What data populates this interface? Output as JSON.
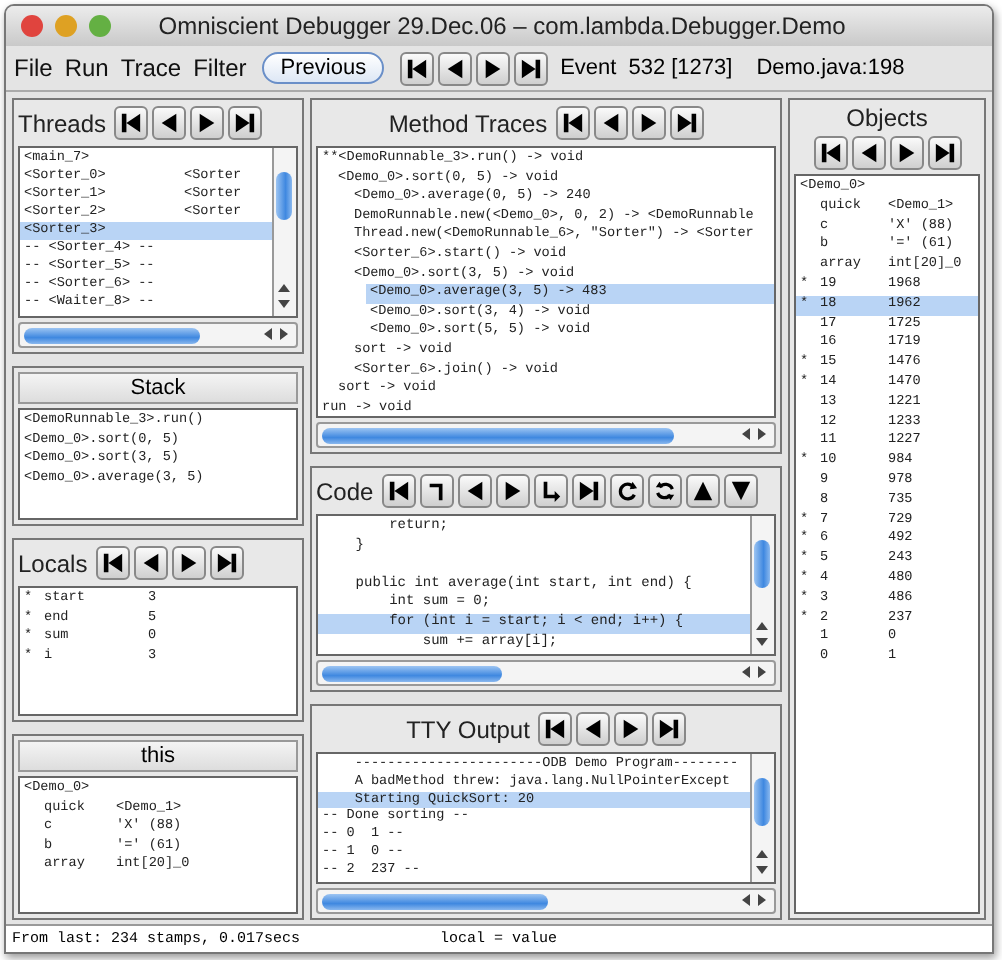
{
  "window": {
    "title": "Omniscient Debugger 29.Dec.06 – com.lambda.Debugger.Demo"
  },
  "menu": [
    "File",
    "Run",
    "Trace",
    "Filter"
  ],
  "toolbar": {
    "previous_button": "Previous",
    "nav": [
      {
        "kind": "first"
      },
      {
        "kind": "prev"
      },
      {
        "kind": "next"
      },
      {
        "kind": "last"
      }
    ],
    "event_label": "Event",
    "event_value": "532 [1273]",
    "location": "Demo.java:198"
  },
  "threads": {
    "title": "Threads",
    "nav": [
      {
        "kind": "first"
      },
      {
        "kind": "prev"
      },
      {
        "kind": "next"
      },
      {
        "kind": "last"
      }
    ],
    "rows": [
      {
        "cells": [
          "<main_7>"
        ],
        "selected": false
      },
      {
        "cells": [
          "<Sorter_0>",
          "<Sorter"
        ],
        "selected": false
      },
      {
        "cells": [
          "<Sorter_1>",
          "<Sorter"
        ],
        "selected": false
      },
      {
        "cells": [
          "<Sorter_2>",
          "<Sorter"
        ],
        "selected": false
      },
      {
        "cells": [
          "<Sorter_3>"
        ],
        "selected": true
      },
      {
        "cells": [
          "-- <Sorter_4> --"
        ],
        "selected": false
      },
      {
        "cells": [
          "-- <Sorter_5> --"
        ],
        "selected": false
      },
      {
        "cells": [
          "-- <Sorter_6> --"
        ],
        "selected": false
      },
      {
        "cells": [
          "-- <Waiter_8> --"
        ],
        "selected": false
      }
    ]
  },
  "stack": {
    "title": "Stack",
    "rows": [
      "<DemoRunnable_3>.run()",
      "<Demo_0>.sort(0, 5)",
      "<Demo_0>.sort(3, 5)",
      "<Demo_0>.average(3, 5)"
    ]
  },
  "locals": {
    "title": "Locals",
    "nav": [
      {
        "kind": "first"
      },
      {
        "kind": "prev"
      },
      {
        "kind": "next"
      },
      {
        "kind": "last"
      }
    ],
    "rows": [
      {
        "mark": "*",
        "name": "start",
        "value": "3"
      },
      {
        "mark": "*",
        "name": "end",
        "value": "5"
      },
      {
        "mark": "*",
        "name": "sum",
        "value": "0"
      },
      {
        "mark": "*",
        "name": "i",
        "value": "3"
      }
    ]
  },
  "this": {
    "title": "this",
    "header": "<Demo_0>",
    "rows": [
      {
        "name": "quick",
        "value": "<Demo_1>"
      },
      {
        "name": "c",
        "value": "'X' (88)"
      },
      {
        "name": "b",
        "value": "'=' (61)"
      },
      {
        "name": "array",
        "value": "int[20]_0"
      }
    ]
  },
  "method_traces": {
    "title": "Method Traces",
    "nav": [
      {
        "kind": "first"
      },
      {
        "kind": "prev"
      },
      {
        "kind": "next"
      },
      {
        "kind": "last"
      }
    ],
    "items": [
      {
        "text": "**<DemoRunnable_3>.run() -> void",
        "selected": false,
        "children": [
          {
            "text": "<Demo_0>.sort(0, 5) -> void",
            "selected": false,
            "children": [
              {
                "text": "<Demo_0>.average(0, 5) -> 240",
                "selected": false
              },
              {
                "text": "DemoRunnable.new(<Demo_0>, 0, 2) -> <DemoRunnable",
                "selected": false
              },
              {
                "text": "Thread.new(<DemoRunnable_6>, \"Sorter\") -> <Sorter",
                "selected": false
              },
              {
                "text": "<Sorter_6>.start() -> void",
                "selected": false
              },
              {
                "text": "<Demo_0>.sort(3, 5) -> void",
                "selected": false,
                "children": [
                  {
                    "text": "<Demo_0>.average(3, 5) -> 483",
                    "selected": true
                  },
                  {
                    "text": "<Demo_0>.sort(3, 4) -> void",
                    "selected": false
                  },
                  {
                    "text": "<Demo_0>.sort(5, 5) -> void",
                    "selected": false
                  }
                ]
              },
              {
                "text": "sort -> void",
                "selected": false
              },
              {
                "text": "<Sorter_6>.join() -> void",
                "selected": false
              }
            ]
          },
          {
            "text": "sort -> void",
            "selected": false
          }
        ]
      },
      {
        "text": "run -> void",
        "selected": false
      }
    ]
  },
  "code": {
    "title": "Code",
    "nav": [
      {
        "kind": "first"
      },
      {
        "kind": "return"
      },
      {
        "kind": "prev"
      },
      {
        "kind": "next"
      },
      {
        "kind": "step"
      },
      {
        "kind": "last"
      },
      {
        "kind": "redo"
      },
      {
        "kind": "refresh"
      },
      {
        "kind": "up"
      },
      {
        "kind": "down"
      }
    ],
    "lines": [
      {
        "text": "        return;",
        "selected": false
      },
      {
        "text": "    }",
        "selected": false
      },
      {
        "selected": false
      },
      {
        "text": "    public int average(int start, int end) {",
        "selected": false
      },
      {
        "text": "        int sum = 0;",
        "selected": false
      },
      {
        "text": "        for (int i = start; i < end; i++) {",
        "selected": true
      },
      {
        "text": "            sum += array[i];",
        "selected": false
      }
    ]
  },
  "tty": {
    "title": "TTY Output",
    "nav": [
      {
        "kind": "first"
      },
      {
        "kind": "prev"
      },
      {
        "kind": "next"
      },
      {
        "kind": "last"
      }
    ],
    "lines": [
      {
        "text": "    -----------------------ODB Demo Program--------",
        "selected": false
      },
      {
        "text": "    A badMethod threw: java.lang.NullPointerExcept",
        "selected": false
      },
      {
        "text": "    Starting QuickSort: 20",
        "selected": true
      },
      {
        "text": "-- Done sorting --",
        "selected": false
      },
      {
        "text": "-- 0  1 --",
        "selected": false
      },
      {
        "text": "-- 1  0 --",
        "selected": false
      },
      {
        "text": "-- 2  237 --",
        "selected": false
      }
    ]
  },
  "objects": {
    "title": "Objects",
    "nav": [
      {
        "kind": "first"
      },
      {
        "kind": "prev"
      },
      {
        "kind": "next"
      },
      {
        "kind": "last"
      }
    ],
    "header": "<Demo_0>",
    "rows": [
      {
        "name": "quick",
        "value": "<Demo_1>",
        "selected": false
      },
      {
        "name": "c",
        "value": "'X' (88)",
        "selected": false
      },
      {
        "name": "b",
        "value": "'=' (61)",
        "selected": false
      },
      {
        "name": "array",
        "value": "int[20]_0",
        "selected": false
      },
      {
        "mark": "*",
        "name": "19",
        "value": "1968",
        "selected": false
      },
      {
        "mark": "*",
        "name": "18",
        "value": "1962",
        "selected": true
      },
      {
        "name": "17",
        "value": "1725",
        "selected": false
      },
      {
        "name": "16",
        "value": "1719",
        "selected": false
      },
      {
        "mark": "*",
        "name": "15",
        "value": "1476",
        "selected": false
      },
      {
        "mark": "*",
        "name": "14",
        "value": "1470",
        "selected": false
      },
      {
        "name": "13",
        "value": "1221",
        "selected": false
      },
      {
        "name": "12",
        "value": "1233",
        "selected": false
      },
      {
        "name": "11",
        "value": "1227",
        "selected": false
      },
      {
        "mark": "*",
        "name": "10",
        "value": "984",
        "selected": false
      },
      {
        "name": "9",
        "value": "978",
        "selected": false
      },
      {
        "name": "8",
        "value": "735",
        "selected": false
      },
      {
        "mark": "*",
        "name": "7",
        "value": "729",
        "selected": false
      },
      {
        "mark": "*",
        "name": "6",
        "value": "492",
        "selected": false
      },
      {
        "mark": "*",
        "name": "5",
        "value": "243",
        "selected": false
      },
      {
        "mark": "*",
        "name": "4",
        "value": "480",
        "selected": false
      },
      {
        "mark": "*",
        "name": "3",
        "value": "486",
        "selected": false
      },
      {
        "mark": "*",
        "name": "2",
        "value": "237",
        "selected": false
      },
      {
        "name": "1",
        "value": "0",
        "selected": false
      },
      {
        "name": "0",
        "value": "1",
        "selected": false
      }
    ]
  },
  "status_bar": {
    "left": "From last: 234 stamps, 0.017secs",
    "right": "local = value"
  }
}
